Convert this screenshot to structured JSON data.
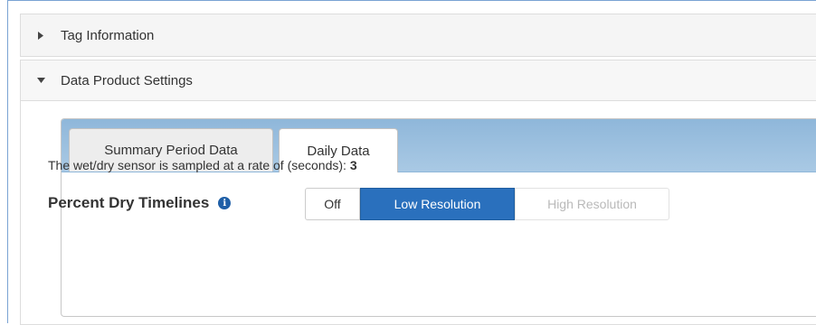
{
  "panels": {
    "tag_information": {
      "title": "Tag Information",
      "expanded": false
    },
    "data_product_settings": {
      "title": "Data Product Settings",
      "expanded": true
    }
  },
  "tabs": [
    {
      "label": "Summary Period Data",
      "active": false
    },
    {
      "label": "Daily Data",
      "active": true
    }
  ],
  "daily_data": {
    "sample_rate_text": "The wet/dry sensor is sampled at a rate of (seconds):",
    "sample_rate_value": "3",
    "percent_dry_label": "Percent Dry Timelines",
    "info_icon": "i",
    "resolution_options": [
      {
        "label": "Off",
        "state": "normal"
      },
      {
        "label": "Low Resolution",
        "state": "selected"
      },
      {
        "label": "High Resolution",
        "state": "disabled"
      }
    ]
  },
  "colors": {
    "tab_bar": "#9dbfdf",
    "selected_button": "#2a70bd",
    "info_icon": "#1f5fa7"
  }
}
